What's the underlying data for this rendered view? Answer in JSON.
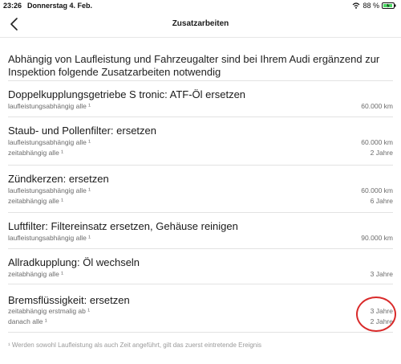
{
  "status_bar": {
    "time": "23:26",
    "date": "Donnerstag 4. Feb.",
    "battery": "88 %"
  },
  "nav": {
    "title": "Zusatzarbeiten",
    "back_icon": "chevron-left-icon"
  },
  "intro": "Abhängig von Laufleistung und Fahrzeugalter sind bei Ihrem Audi ergänzend zur Inspektion folgende Zusatzarbeiten notwendig",
  "sections": [
    {
      "title": "Doppelkupplungsgetriebe S tronic: ATF-Öl ersetzen",
      "rows": [
        {
          "label": "laufleistungsabhängig alle ¹",
          "value": "60.000 km"
        }
      ]
    },
    {
      "title": "Staub- und Pollenfilter: ersetzen",
      "rows": [
        {
          "label": "laufleistungsabhängig alle ¹",
          "value": "60.000 km"
        },
        {
          "label": "zeitabhängig alle ¹",
          "value": "2 Jahre"
        }
      ]
    },
    {
      "title": "Zündkerzen: ersetzen",
      "rows": [
        {
          "label": "laufleistungsabhängig alle ¹",
          "value": "60.000 km"
        },
        {
          "label": "zeitabhängig alle ¹",
          "value": "6 Jahre"
        }
      ]
    },
    {
      "title": "Luftfilter: Filtereinsatz ersetzen, Gehäuse reinigen",
      "rows": [
        {
          "label": "laufleistungsabhängig alle ¹",
          "value": "90.000 km"
        }
      ]
    },
    {
      "title": "Allradkupplung: Öl wechseln",
      "rows": [
        {
          "label": "zeitabhängig alle ¹",
          "value": "3 Jahre"
        }
      ]
    },
    {
      "title": "Bremsflüssigkeit: ersetzen",
      "rows": [
        {
          "label": "zeitabhängig erstmalig ab ¹",
          "value": "3 Jahre"
        },
        {
          "label": "danach alle ¹",
          "value": "2 Jahre"
        }
      ]
    }
  ],
  "footnote": "¹ Werden sowohl Laufleistung als auch Zeit angeführt, gilt das zuerst eintretende Ereignis",
  "colors": {
    "annotation": "#d92a2a",
    "battery": "#4cd964"
  }
}
